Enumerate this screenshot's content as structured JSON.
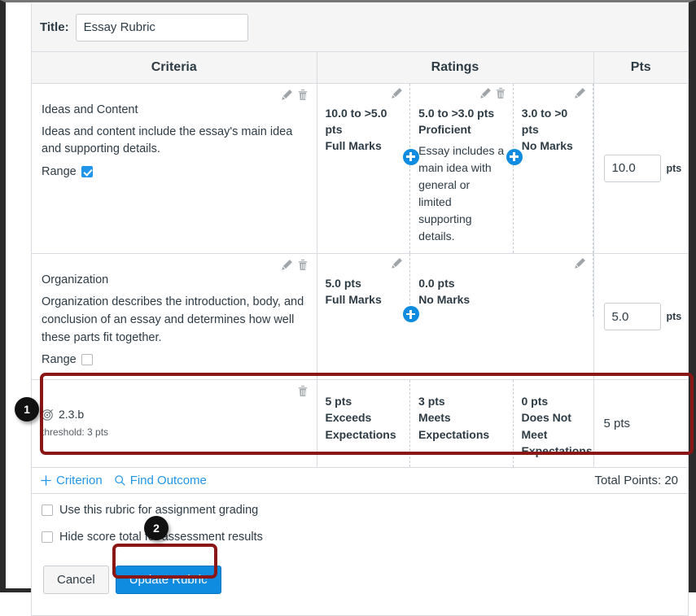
{
  "title_field": {
    "label": "Title:",
    "value": "Essay Rubric"
  },
  "columns": {
    "criteria": "Criteria",
    "ratings": "Ratings",
    "pts": "Pts"
  },
  "criteria": [
    {
      "name": "Ideas and Content",
      "description": "Ideas and content include the essay's main idea and supporting details.",
      "range_label": "Range",
      "range_checked": true,
      "points_value": "10.0",
      "points_suffix": "pts",
      "ratings": [
        {
          "points": "10.0 to >5.0 pts",
          "name": "Full Marks",
          "description": ""
        },
        {
          "points": "5.0 to >3.0 pts",
          "name": "Proficient",
          "description": "Essay includes a main idea with general or limited supporting details."
        },
        {
          "points": "3.0 to >0 pts",
          "name": "No Marks",
          "description": ""
        }
      ]
    },
    {
      "name": "Organization",
      "description": "Organization describes the introduction, body, and conclusion of an essay and determines how well these parts fit together.",
      "range_label": "Range",
      "range_checked": false,
      "points_value": "5.0",
      "points_suffix": "pts",
      "ratings": [
        {
          "points": "5.0 pts",
          "name": "Full Marks",
          "description": ""
        },
        {
          "points": "0.0 pts",
          "name": "No Marks",
          "description": ""
        }
      ]
    }
  ],
  "outcome": {
    "name": "2.3.b",
    "threshold": "threshold: 3 pts",
    "points_display": "5 pts",
    "ratings": [
      {
        "points": "5 pts",
        "name": "Exceeds Expectations"
      },
      {
        "points": "3 pts",
        "name": "Meets Expectations"
      },
      {
        "points": "0 pts",
        "name": "Does Not Meet Expectations"
      }
    ]
  },
  "footer": {
    "criterion_link": "Criterion",
    "find_outcome_link": "Find Outcome",
    "total_points": "Total Points: 20"
  },
  "options": {
    "use_for_grading": "Use this rubric for assignment grading",
    "hide_score_total": "Hide score total for assessment results"
  },
  "buttons": {
    "cancel": "Cancel",
    "update": "Update Rubric"
  },
  "annotations": {
    "badge1": "1",
    "badge2": "2"
  },
  "colors": {
    "accent_blue": "#0f8ce0",
    "link_blue": "#2196e8",
    "highlight_red": "#8a1616",
    "text": "#2d3b45"
  }
}
